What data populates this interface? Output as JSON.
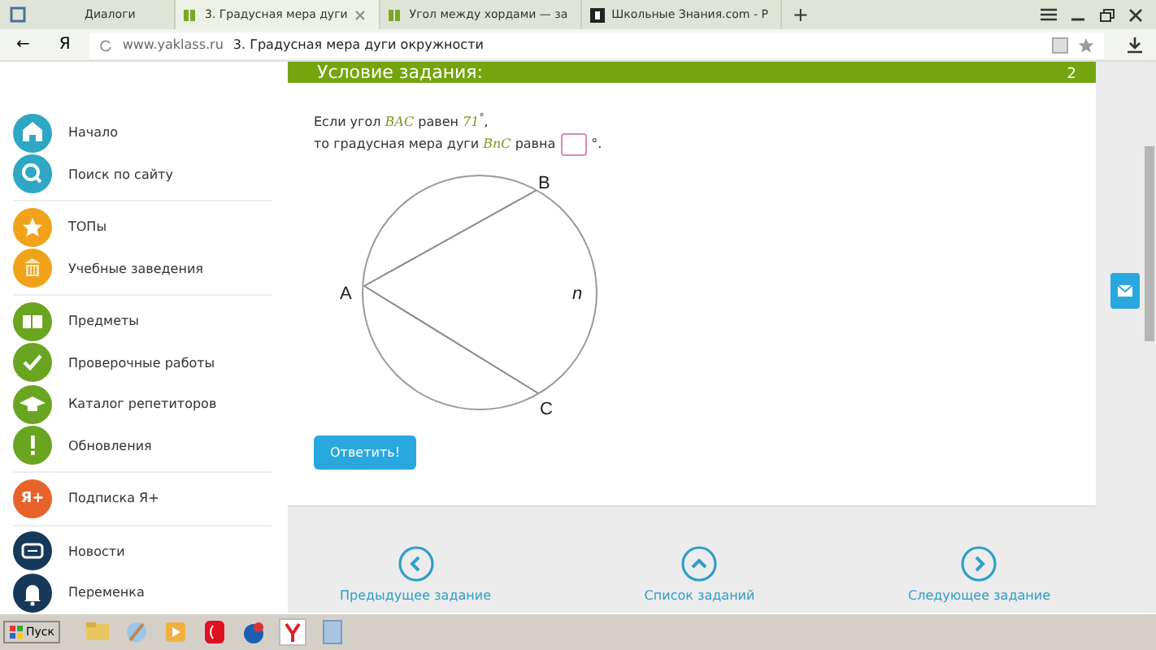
{
  "browser": {
    "tabs": [
      {
        "label": "Диалоги",
        "selected": false,
        "kind": "app"
      },
      {
        "label": "3. Градусная мера дуги",
        "selected": true,
        "kind": "page"
      },
      {
        "label": "Угол между хордами — за",
        "selected": false,
        "kind": "page"
      },
      {
        "label": "Школьные Знания.com - Р",
        "selected": false,
        "kind": "site"
      }
    ],
    "new_tab": "+",
    "back": "←",
    "logo": "Я",
    "url": "www.yaklass.ru",
    "page_title": "3. Градусная мера дуги окружности"
  },
  "sidebar": {
    "groups": [
      [
        {
          "label": "Начало",
          "color": "#2ea7c4"
        },
        {
          "label": "Поиск по сайту",
          "color": "#2ea7c4"
        }
      ],
      [
        {
          "label": "ТОПы",
          "color": "#f0a31a"
        },
        {
          "label": "Учебные заведения",
          "color": "#f0a31a"
        }
      ],
      [
        {
          "label": "Предметы",
          "color": "#6aa521"
        },
        {
          "label": "Проверочные работы",
          "color": "#6aa521"
        },
        {
          "label": "Каталог репетиторов",
          "color": "#6aa521"
        },
        {
          "label": "Обновления",
          "color": "#6aa521"
        }
      ],
      [
        {
          "label": "Подписка Я+",
          "color": "#e8632a",
          "glyph": "Я+"
        }
      ],
      [
        {
          "label": "Новости",
          "color": "#16395a"
        },
        {
          "label": "Переменка",
          "color": "#16395a"
        }
      ]
    ]
  },
  "task": {
    "header": "Условие задания:",
    "points": "2",
    "line_1": "Если угол *BAC* равен *71*$^{°}$,",
    "line_2_before": "то градусная мера дуги *BnC* равна",
    "line_2_after": "°.",
    "figure": {
      "labels": [
        "A",
        "B",
        "C",
        "n"
      ]
    },
    "submit": "Ответить!"
  },
  "navigation": [
    {
      "label": "Предыдущее задание"
    },
    {
      "label": "Список заданий"
    },
    {
      "label": "Следующее задание"
    }
  ],
  "taskbar": {
    "start": "Пуск"
  }
}
